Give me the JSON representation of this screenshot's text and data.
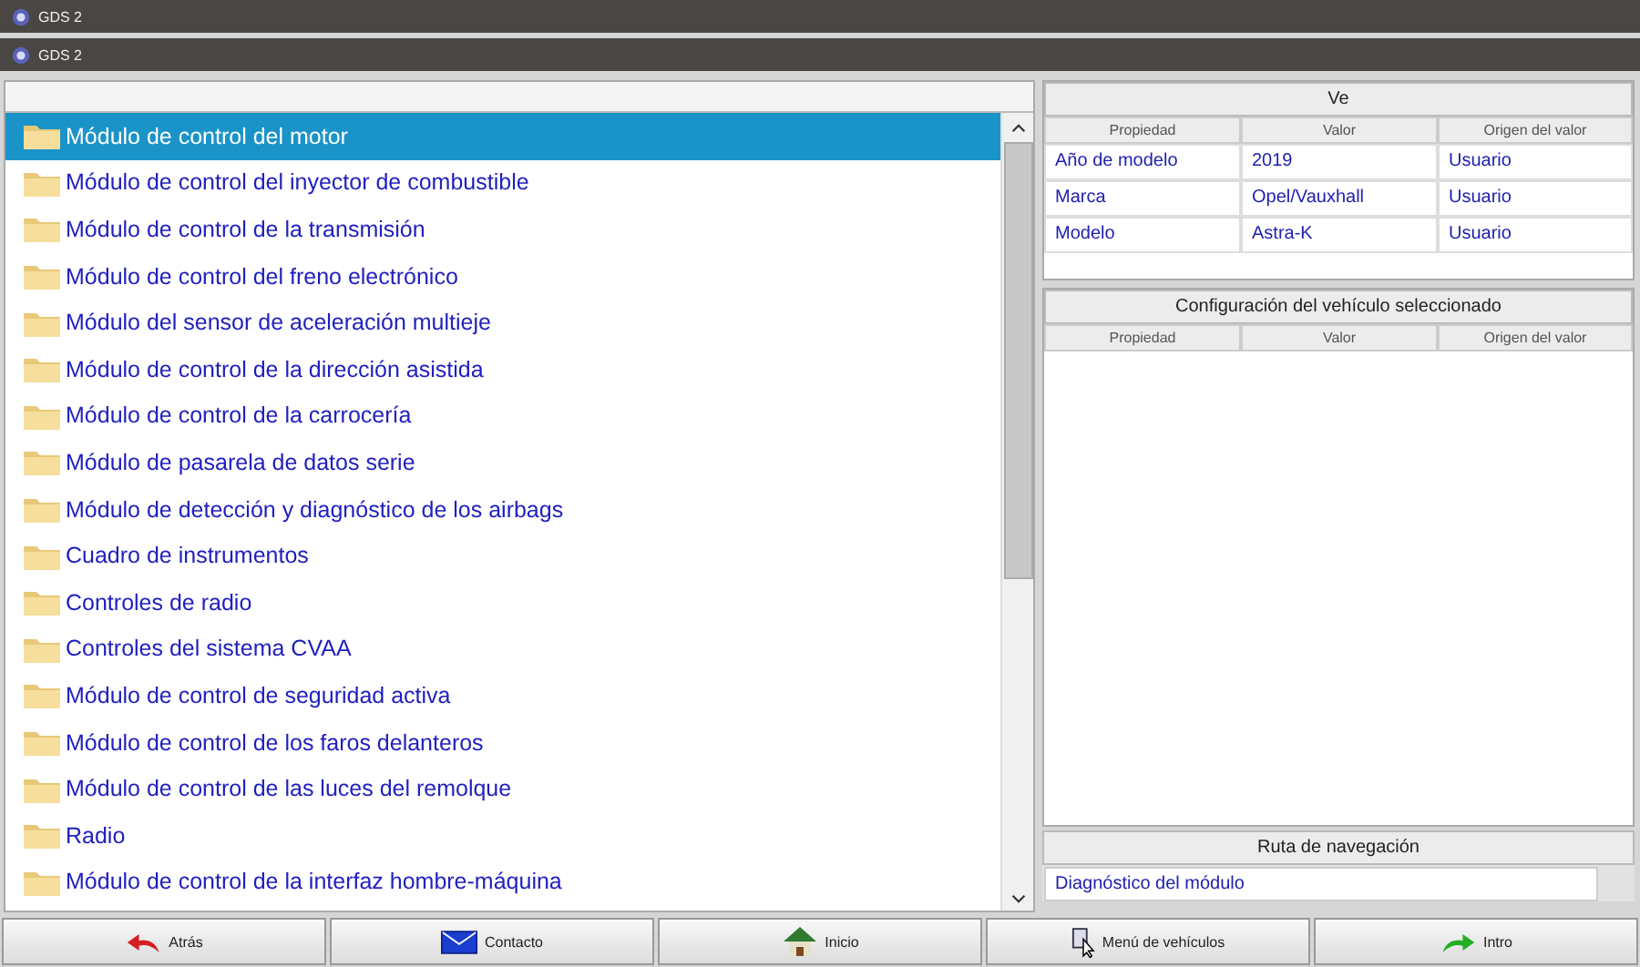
{
  "windows": [
    {
      "title": "GDS 2"
    },
    {
      "title": "GDS 2"
    }
  ],
  "modules": {
    "items": [
      {
        "label": "Módulo de control del motor",
        "selected": true
      },
      {
        "label": "Módulo de control del inyector de combustible",
        "selected": false
      },
      {
        "label": "Módulo de control de la transmisión",
        "selected": false
      },
      {
        "label": "Módulo de control del freno electrónico",
        "selected": false
      },
      {
        "label": "Módulo del sensor de aceleración multieje",
        "selected": false
      },
      {
        "label": "Módulo de control de la dirección asistida",
        "selected": false
      },
      {
        "label": "Módulo de control de la carrocería",
        "selected": false
      },
      {
        "label": "Módulo de pasarela de datos serie",
        "selected": false
      },
      {
        "label": "Módulo de detección y diagnóstico de los airbags",
        "selected": false
      },
      {
        "label": "Cuadro de instrumentos",
        "selected": false
      },
      {
        "label": "Controles de radio",
        "selected": false
      },
      {
        "label": "Controles del sistema CVAA",
        "selected": false
      },
      {
        "label": "Módulo de control de seguridad activa",
        "selected": false
      },
      {
        "label": "Módulo de control de los faros delanteros",
        "selected": false
      },
      {
        "label": "Módulo de control de las luces del remolque",
        "selected": false
      },
      {
        "label": "Radio",
        "selected": false
      },
      {
        "label": "Módulo de control de la interfaz hombre-máquina",
        "selected": false
      }
    ]
  },
  "vehicle": {
    "title": "Ve",
    "columns": [
      "Propiedad",
      "Valor",
      "Origen del valor"
    ],
    "rows": [
      [
        "Año de modelo",
        "2019",
        "Usuario"
      ],
      [
        "Marca",
        "Opel/Vauxhall",
        "Usuario"
      ],
      [
        "Modelo",
        "Astra-K",
        "Usuario"
      ]
    ]
  },
  "configuration": {
    "title": "Configuración del vehículo seleccionado",
    "columns": [
      "Propiedad",
      "Valor",
      "Origen del valor"
    ]
  },
  "navigation": {
    "title": "Ruta de navegación",
    "path": "Diagnóstico del módulo"
  },
  "buttons": [
    {
      "kind": "back",
      "label": "Atrás"
    },
    {
      "kind": "contact",
      "label": "Contacto"
    },
    {
      "kind": "home",
      "label": "Inicio"
    },
    {
      "kind": "vehicles",
      "label": "Menú de vehículos"
    },
    {
      "kind": "enter",
      "label": "Intro"
    }
  ]
}
